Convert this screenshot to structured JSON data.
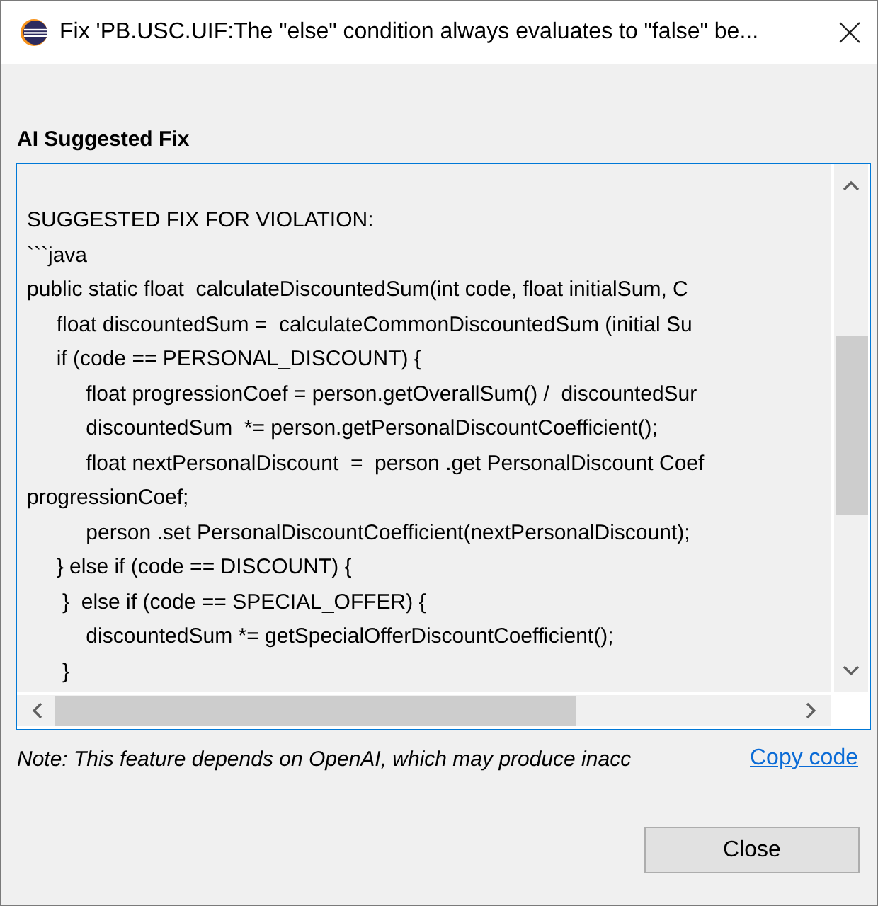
{
  "window": {
    "title": "Fix 'PB.USC.UIF:The \"else\" condition always evaluates to \"false\" be..."
  },
  "section": {
    "heading": "AI Suggested Fix",
    "code_area": {
      "focused": true,
      "lines": [
        "SUGGESTED FIX FOR VIOLATION:",
        "```java",
        "public static float  calculateDiscountedSum(int code, float initialSum, C",
        "     float discountedSum =  calculateCommonDiscountedSum (initial Su",
        "     if (code == PERSONAL_DISCOUNT) {",
        "          float progressionCoef = person.getOverallSum() /  discountedSur",
        "          discountedSum  *= person.getPersonalDiscountCoefficient();",
        "          float nextPersonalDiscount  =  person .get PersonalDiscount Coef",
        "progressionCoef;",
        "          person .set PersonalDiscountCoefficient(nextPersonalDiscount);",
        "     } else if (code == DISCOUNT) {",
        "      }  else if (code == SPECIAL_OFFER) {",
        "          discountedSum *= getSpecialOfferDiscountCoefficient();",
        "      }"
      ]
    }
  },
  "note": {
    "text": "Note: This feature depends on OpenAI, which may produce inacc",
    "link": "Copy code"
  },
  "buttons": [
    {
      "label": "Close"
    }
  ]
}
